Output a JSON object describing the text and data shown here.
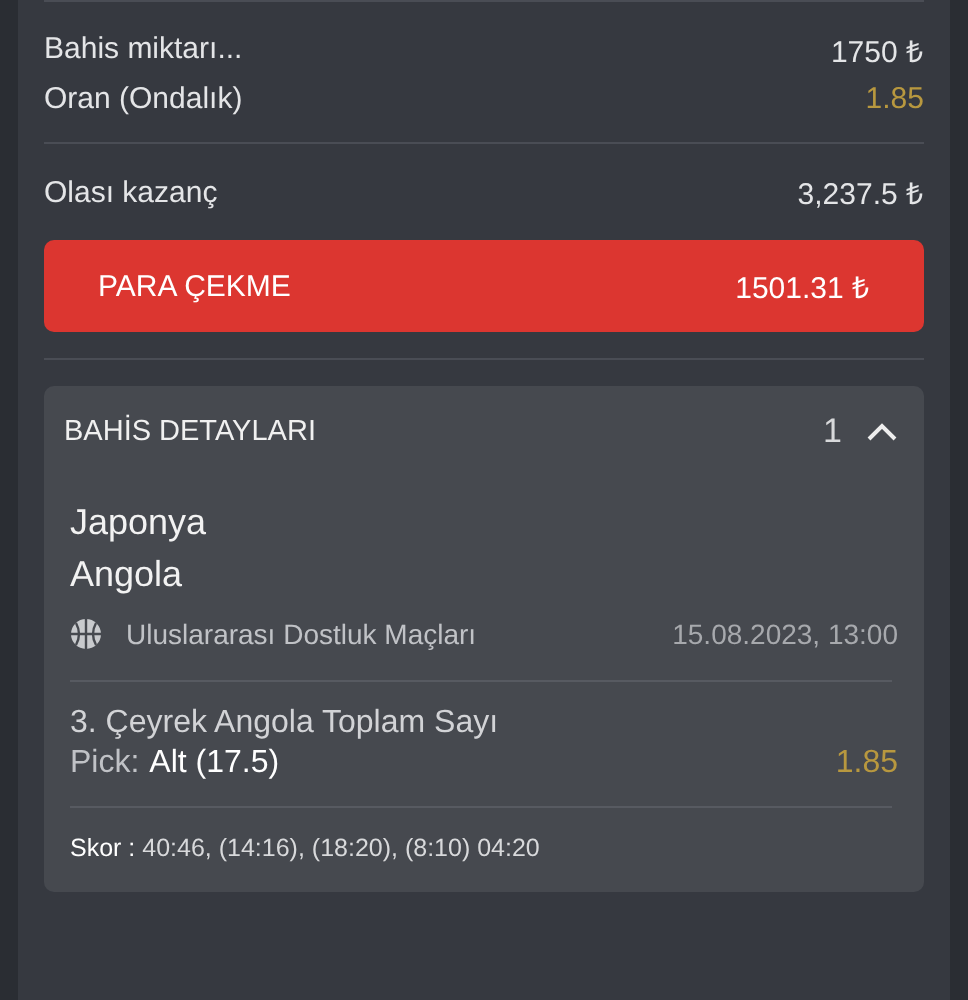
{
  "summary": {
    "rows": [
      {
        "label": "Bahis miktarı...",
        "value": "1750 ₺",
        "kind": "amount"
      },
      {
        "label": "Oran (Ondalık)",
        "value": "1.85",
        "kind": "odds"
      }
    ],
    "potential": {
      "label": "Olası kazanç",
      "value": "3,237.5 ₺"
    }
  },
  "cashout": {
    "label": "PARA ÇEKME",
    "value": "1501.31 ₺"
  },
  "details": {
    "title": "BAHİS DETAYLARI",
    "count": "1",
    "expanded": true,
    "home": "Japonya",
    "away": "Angola",
    "league": "Uluslararası Dostluk Maçları",
    "date": "15.08.2023, 13:00",
    "market": "3. Çeyrek Angola Toplam Sayı",
    "pick_label": "Pick:",
    "pick_value": "Alt (17.5)",
    "odds": "1.85",
    "score": "**Skor :** 40:46, (14:16), (18:20), (8:10) 04:20"
  }
}
